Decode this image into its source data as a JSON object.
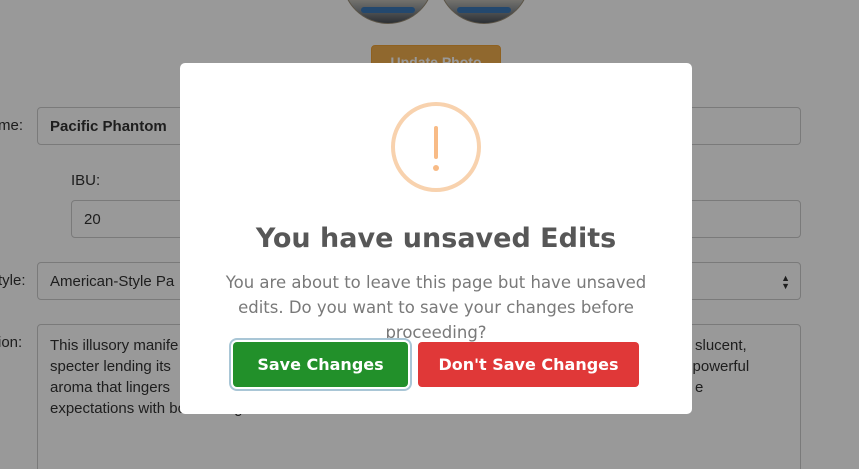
{
  "page": {
    "update_photo_label": "Update Photo",
    "name_label": "me:",
    "name_value": "Pacific Phantom",
    "ibu_label": "IBU:",
    "ibu_value": "20",
    "style_label": "tyle:",
    "style_value": "American-Style Pa",
    "description_label": "ion:",
    "description_lines": [
      "This illusory manife",
      "specter lending its",
      "aroma that lingers",
      "expectations with bold intangible flavor."
    ],
    "description_right_fragments": [
      "slucent,",
      "a powerful",
      "e"
    ]
  },
  "modal": {
    "title": "You have unsaved Edits",
    "message": "You are about to leave this page but have unsaved edits. Do you want to save your changes before proceeding?",
    "save_label": "Save Changes",
    "dont_save_label": "Don't Save Changes"
  },
  "colors": {
    "overlay": "#000000",
    "warning": "#f8bb86",
    "save_button": "#22902a",
    "dont_save_button": "#e03838",
    "update_photo_button": "#f0ad4e"
  },
  "icons": [
    "warning-exclamation-icon",
    "select-caret-icon"
  ]
}
